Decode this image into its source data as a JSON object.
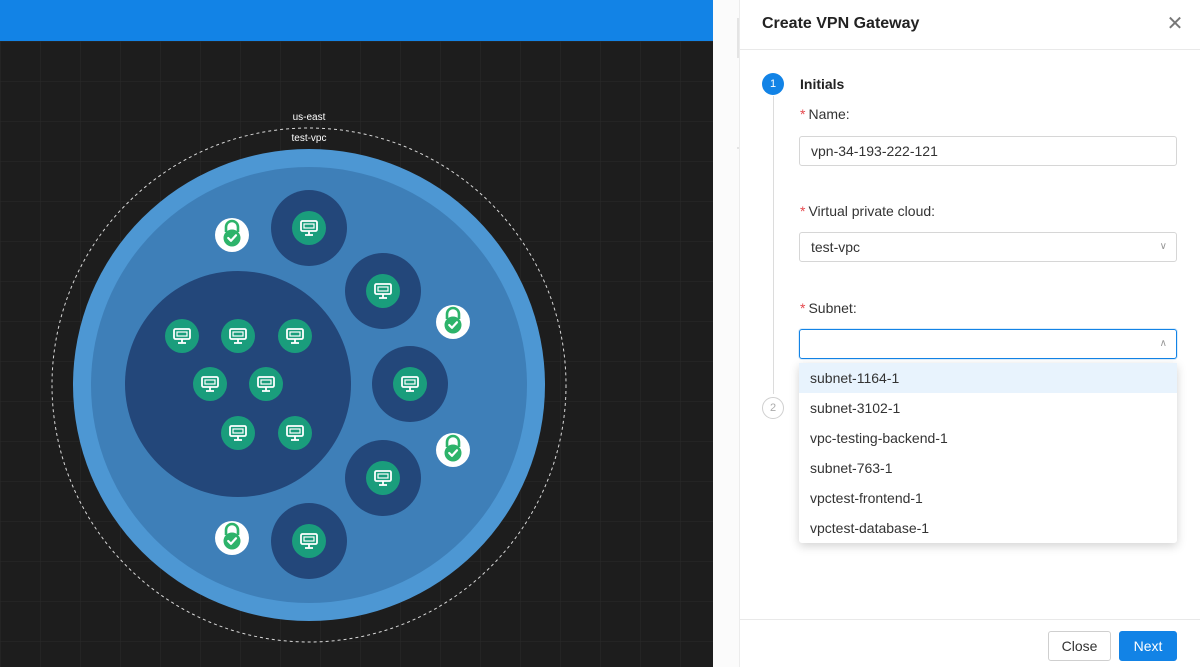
{
  "topology": {
    "region_label": "us-east",
    "vpc_label": "test-vpc"
  },
  "drawer": {
    "title": "Create VPN Gateway",
    "close_icon": "close-icon",
    "steps": [
      {
        "number": "1",
        "title": "Initials"
      },
      {
        "number": "2"
      }
    ],
    "form": {
      "name_label": "Name:",
      "name_value": "vpn-34-193-222-121",
      "vpc_label": "Virtual private cloud:",
      "vpc_value": "test-vpc",
      "subnet_label": "Subnet:",
      "subnet_value": "",
      "required_mark": "*"
    },
    "subnet_options": [
      "subnet-1164-1",
      "subnet-3102-1",
      "vpc-testing-backend-1",
      "subnet-763-1",
      "vpctest-frontend-1",
      "vpctest-database-1"
    ],
    "buttons": {
      "close": "Close",
      "next": "Next"
    }
  },
  "colors": {
    "accent": "#1283e6",
    "vpc_outer": "#4a93cf",
    "vpc_inner": "#2f6fa8",
    "subnet": "#23477a",
    "instance": "#1a9d7c",
    "security": "#2db36a"
  }
}
